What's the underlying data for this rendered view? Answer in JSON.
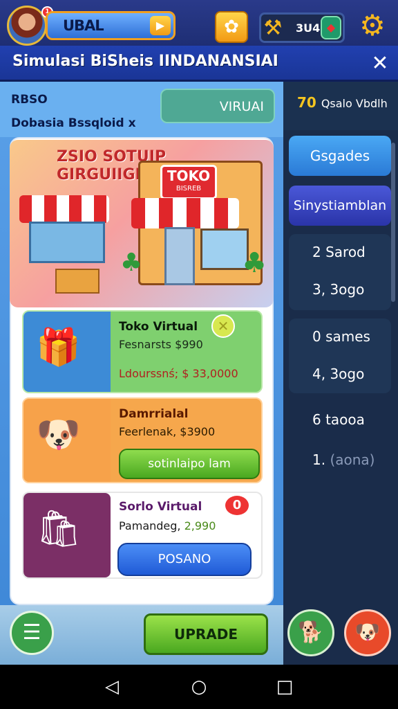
{
  "header": {
    "player_name": "UBAL",
    "notification_count": "1",
    "resource_value": "3U4",
    "page_title": "Simulasi BiSheis IINDANANSIAI"
  },
  "info": {
    "line1": "RBSO",
    "line2": "Dobasia Bssqloid",
    "line2_suffix": "x",
    "virtual_tab": "VIRUAI"
  },
  "hero": {
    "title_line1": "ZSIO SOTUIP",
    "title_line2": "GIRGUIIGN",
    "store_sign": "TOKO",
    "store_sign_sub": "BISREB"
  },
  "cards": [
    {
      "title": "Toko Virtual",
      "line2": "Fesnarsts $990",
      "line3": "Ldourssnś; $ 33,0000"
    },
    {
      "title": "Damrrialal",
      "line2": "Feerlenak, $3900",
      "button": "sotinlaipo lam"
    },
    {
      "title": "Sorlo Virtual",
      "line2": "Pamandeg,",
      "line2_value": "2,990",
      "button": "POSANO",
      "badge": "0"
    }
  ],
  "bottom": {
    "upgrade_label": "UPRADE"
  },
  "sidebar": {
    "header_value": "70",
    "header_label": "Qsalo Vbdlh",
    "btn1": "Gsgades",
    "btn2": "Sinystiamblan",
    "group1": [
      "2 Sarod",
      "3, 3ogo"
    ],
    "group2": [
      "0 sames",
      "4, 3ogo"
    ],
    "row5": "6 taooa",
    "row6_num": "1.",
    "row6_text": "(aona)"
  },
  "colors": {
    "accent": "#2140b0",
    "gold": "#f4b720",
    "green": "#4aa820",
    "blue": "#1f5ad6"
  },
  "icons": [
    "trophy-icon",
    "hammer-icon",
    "gem-icon",
    "gear-icon",
    "close-icon",
    "document-icon",
    "dog-icon",
    "avatar-icon",
    "back-icon",
    "home-icon",
    "recents-icon"
  ]
}
